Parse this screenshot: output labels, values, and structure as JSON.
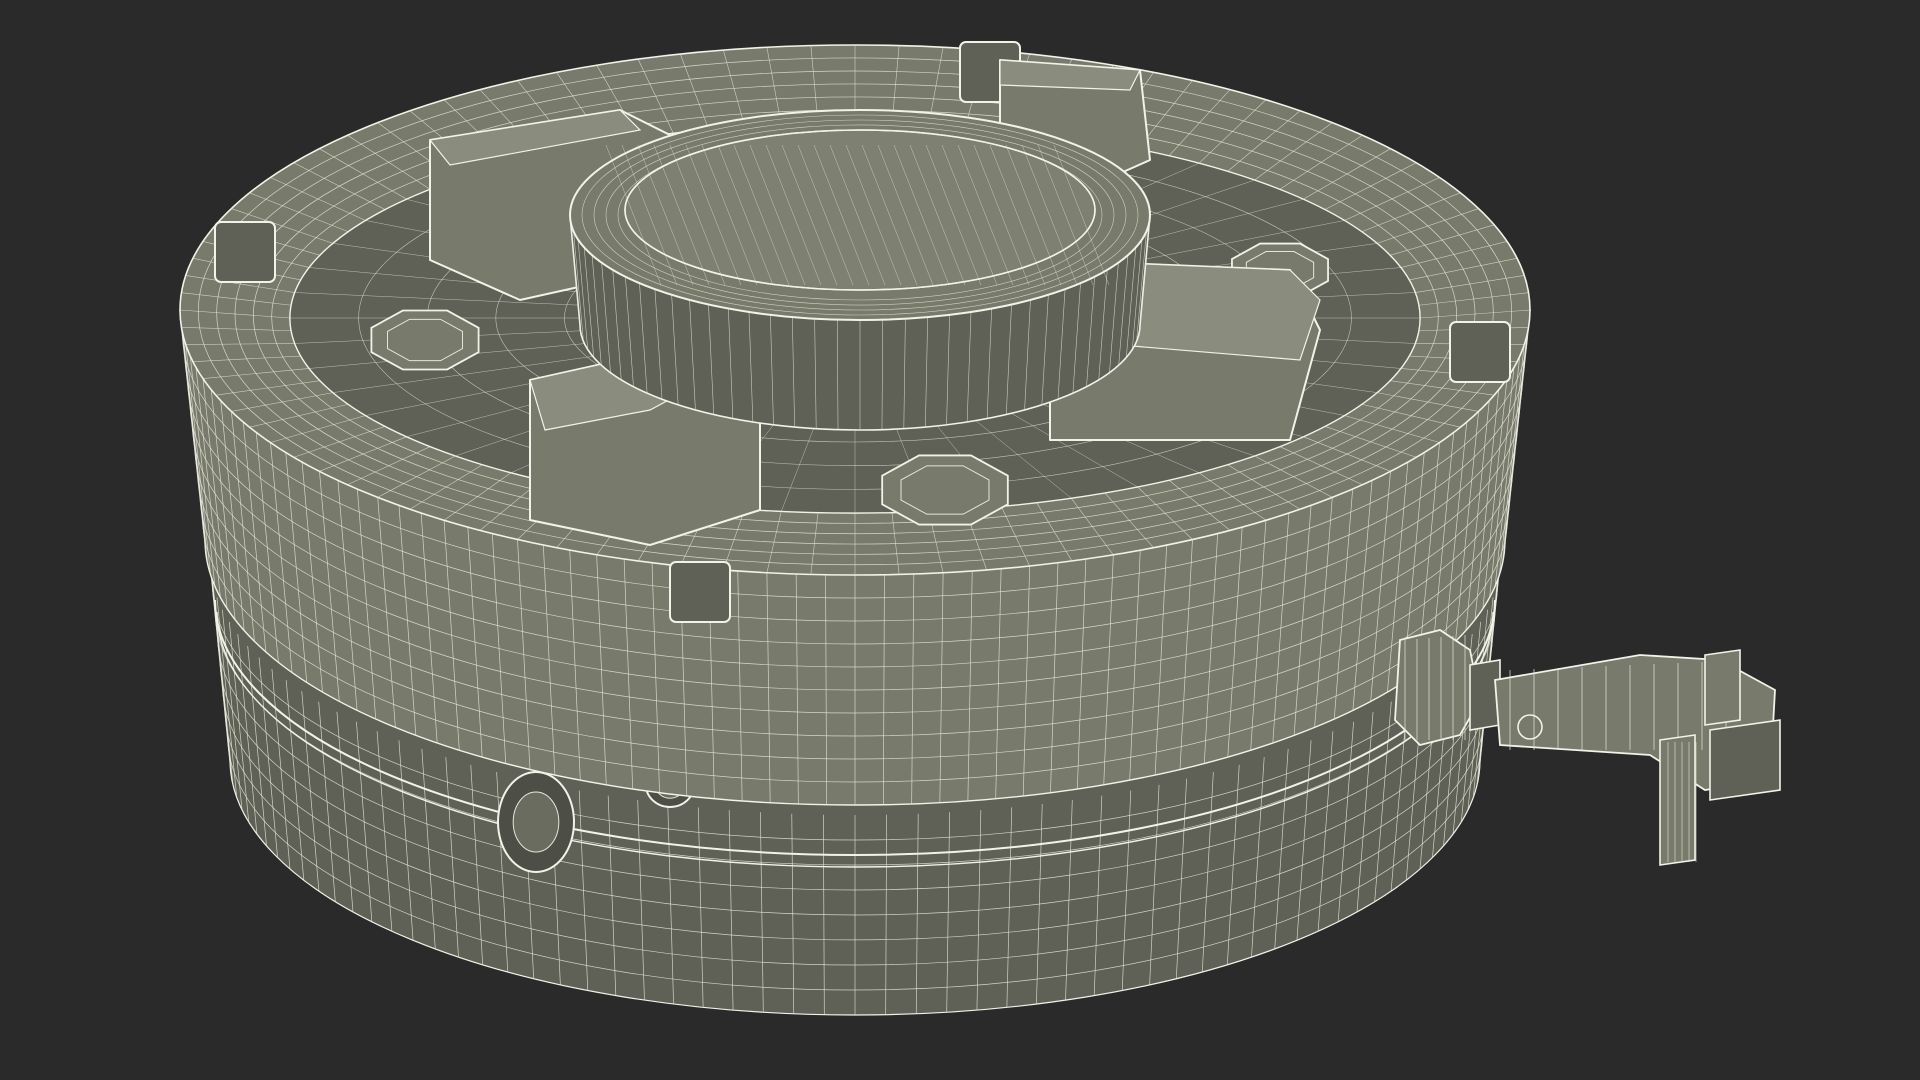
{
  "scene": {
    "background_color": "#2a2a2a",
    "surface_color": "#787a6c",
    "surface_dark_color": "#5f6156",
    "wire_color": "#e6e6d8",
    "edge_color": "#f2f2e8",
    "subject": "mine-wireframe-render"
  }
}
